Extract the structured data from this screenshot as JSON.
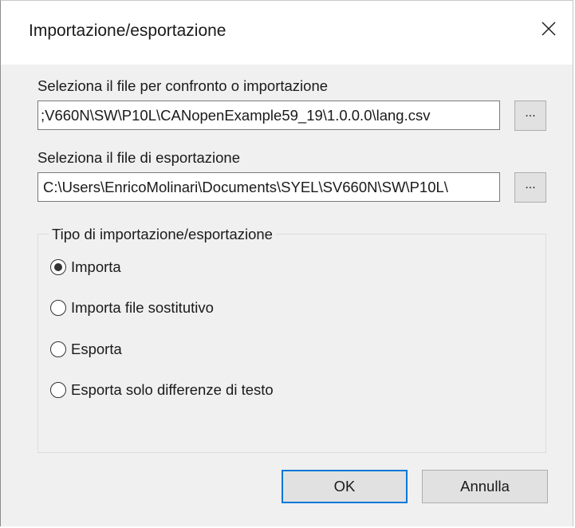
{
  "window": {
    "title": "Importazione/esportazione"
  },
  "import_file": {
    "label": "Seleziona il file per confronto o importazione",
    "value": ";V660N\\SW\\P10L\\CANopenExample59_19\\1.0.0.0\\lang.csv",
    "browse_label": "..."
  },
  "export_file": {
    "label": "Seleziona il file di esportazione",
    "value": "C:\\Users\\EnricoMolinari\\Documents\\SYEL\\SV660N\\SW\\P10L\\",
    "browse_label": "..."
  },
  "mode_group": {
    "legend": "Tipo di importazione/esportazione",
    "options": [
      {
        "label": "Importa",
        "selected": true
      },
      {
        "label": "Importa file sostitutivo",
        "selected": false
      },
      {
        "label": "Esporta",
        "selected": false
      },
      {
        "label": "Esporta solo differenze di testo",
        "selected": false
      }
    ]
  },
  "buttons": {
    "ok": "OK",
    "cancel": "Annulla"
  },
  "colors": {
    "dialog_bg": "#f0f0f0",
    "default_button_border": "#0078d7"
  }
}
